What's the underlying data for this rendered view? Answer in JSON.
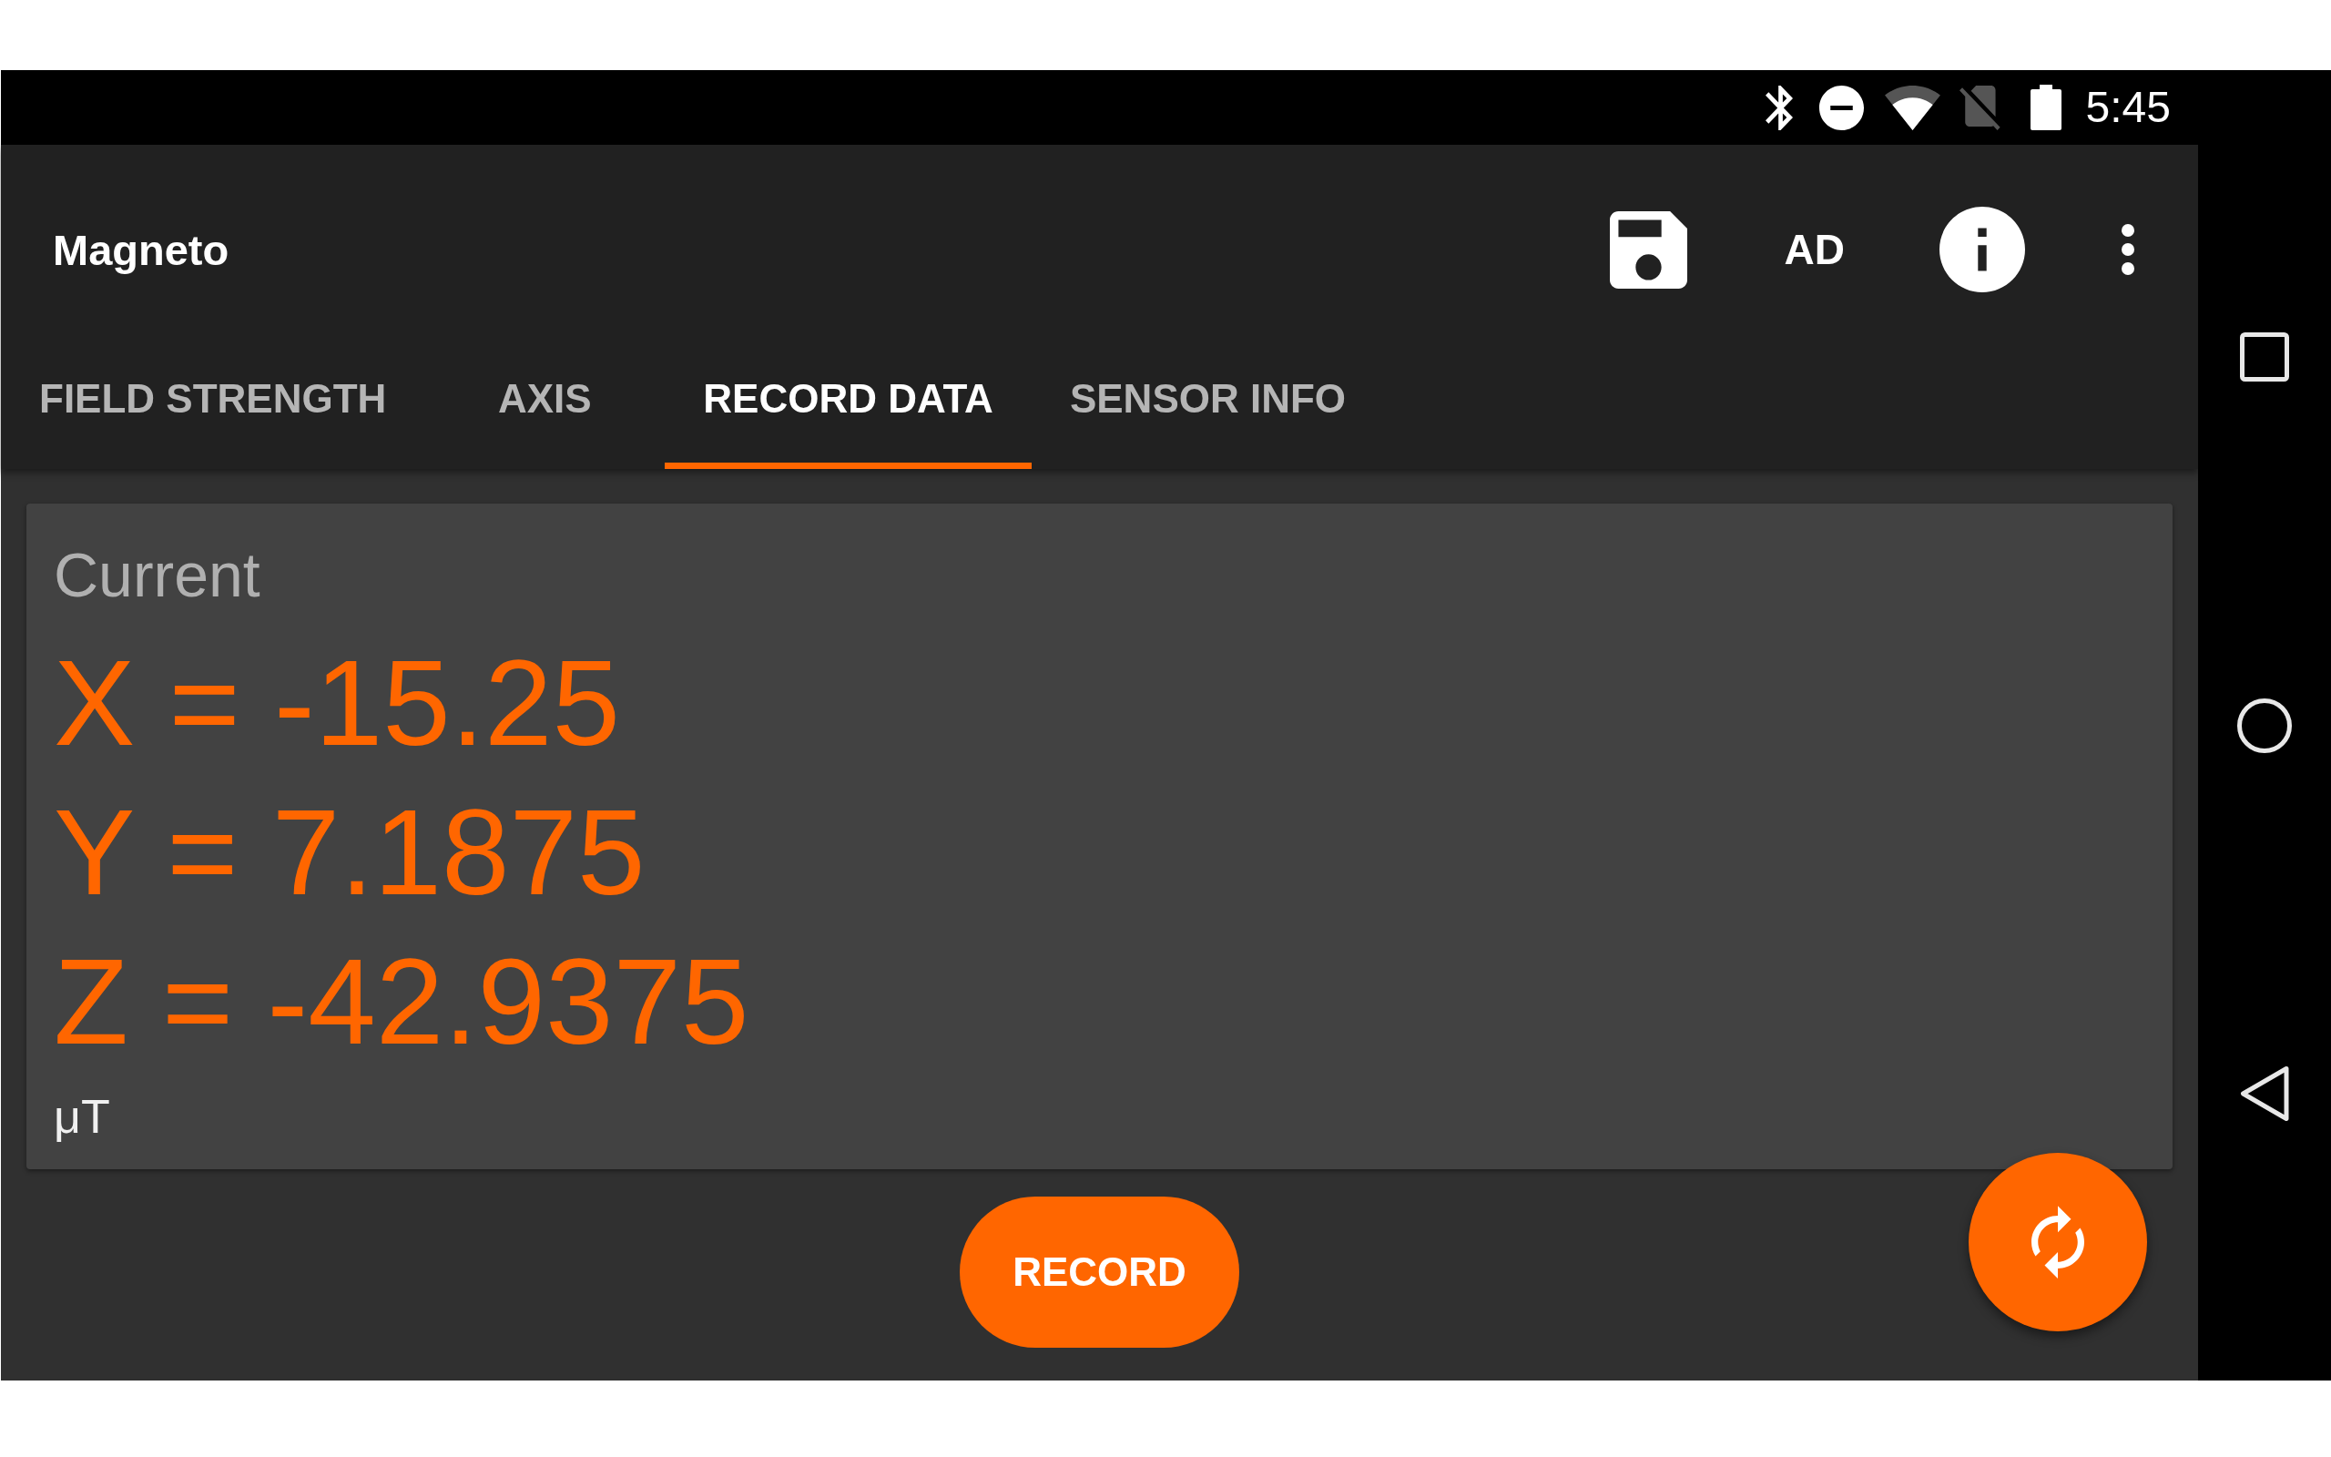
{
  "status_bar": {
    "time": "5:45"
  },
  "app_bar": {
    "title": "Magneto",
    "action_label": "AD"
  },
  "tabs": [
    {
      "label": "FIELD STRENGTH",
      "selected": false
    },
    {
      "label": "AXIS",
      "selected": false
    },
    {
      "label": "RECORD DATA",
      "selected": true
    },
    {
      "label": "SENSOR INFO",
      "selected": false
    }
  ],
  "current_card": {
    "heading": "Current",
    "readings": [
      "X = -15.25",
      "Y = 7.1875",
      "Z = -42.9375"
    ],
    "unit": "μT"
  },
  "record_button": {
    "label": "RECORD"
  }
}
